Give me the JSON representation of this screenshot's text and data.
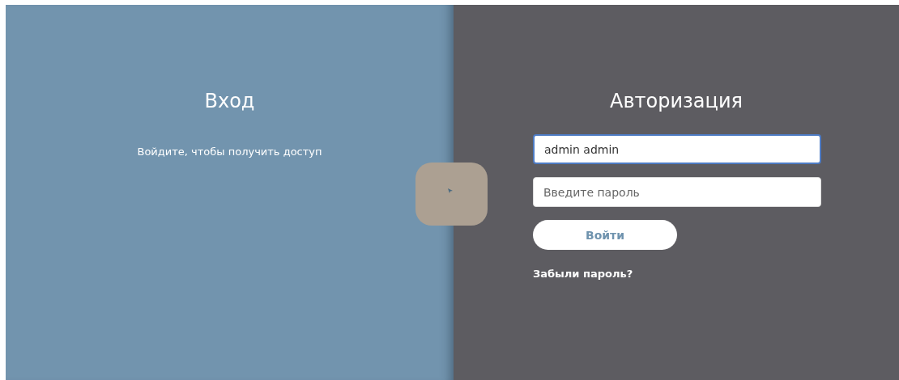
{
  "intro_panel": {
    "title": "Вход",
    "text": "Войдите, чтобы получить доступ"
  },
  "login_panel": {
    "title": "Авторизация",
    "fields": [
      {
        "kind": "text",
        "value": "admin admin",
        "focused": true
      },
      {
        "kind": "password",
        "placeholder": "Введите пароль",
        "focused": false
      }
    ],
    "submit_button": "Войти",
    "forgot_link": "Забыли пароль?"
  }
}
